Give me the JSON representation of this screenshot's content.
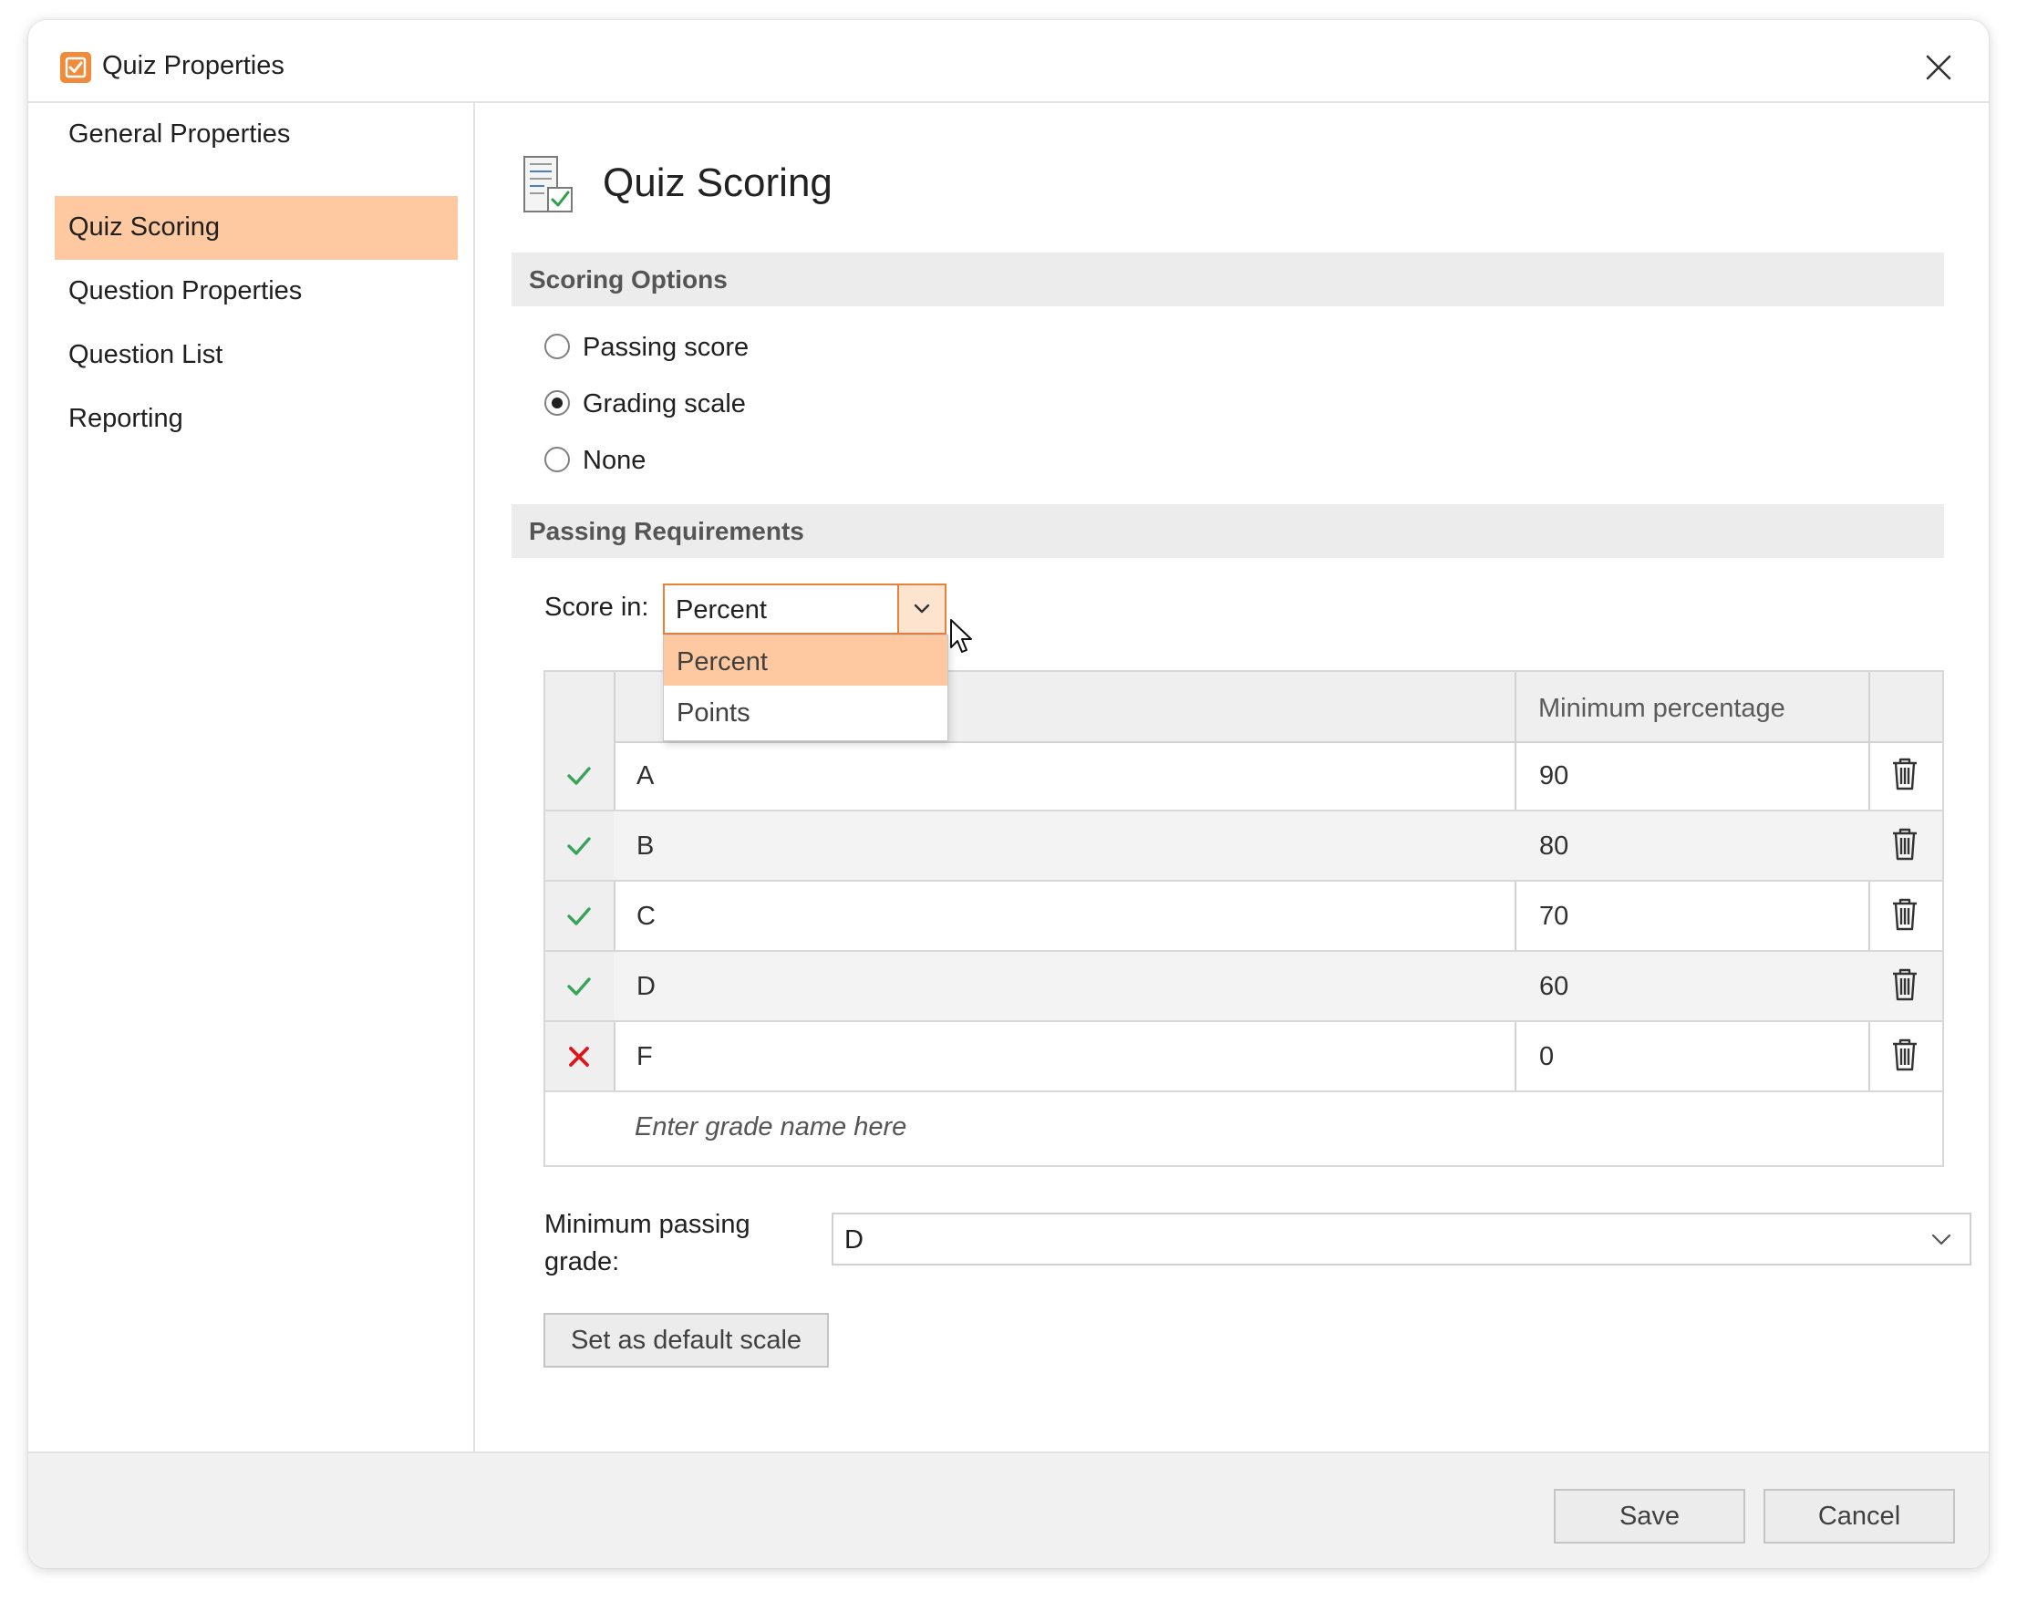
{
  "window": {
    "title": "Quiz Properties"
  },
  "sidebar": {
    "items": [
      {
        "label": "General Properties"
      },
      {
        "label": "Quiz Scoring",
        "active": true
      },
      {
        "label": "Question Properties"
      },
      {
        "label": "Question List"
      },
      {
        "label": "Reporting"
      }
    ]
  },
  "main": {
    "page_title": "Quiz Scoring",
    "scoring_options": {
      "header": "Scoring Options",
      "options": [
        {
          "label": "Passing score",
          "checked": false
        },
        {
          "label": "Grading scale",
          "checked": true
        },
        {
          "label": "None",
          "checked": false
        }
      ]
    },
    "passing_requirements": {
      "header": "Passing Requirements",
      "score_in_label": "Score in:",
      "score_in_value": "Percent",
      "score_in_options": [
        "Percent",
        "Points"
      ],
      "score_in_highlighted": "Percent"
    },
    "grade_table": {
      "columns": [
        "",
        "",
        "Minimum percentage",
        ""
      ],
      "rows": [
        {
          "status": "pass",
          "name": "A",
          "min": "90"
        },
        {
          "status": "pass",
          "name": "B",
          "min": "80"
        },
        {
          "status": "pass",
          "name": "C",
          "min": "70"
        },
        {
          "status": "pass",
          "name": "D",
          "min": "60"
        },
        {
          "status": "fail",
          "name": "F",
          "min": "0"
        }
      ],
      "new_row_placeholder": "Enter grade name here"
    },
    "minimum_passing_grade": {
      "label": "Minimum passing grade:",
      "value": "D"
    },
    "default_scale_button": "Set as default scale"
  },
  "footer": {
    "save_label": "Save",
    "cancel_label": "Cancel"
  },
  "colors": {
    "accent": "#ef8b3a",
    "selection": "#fec9a0",
    "pass": "#3aa35a",
    "fail": "#e0141c"
  },
  "icons": [
    "quiz-app-icon",
    "close-icon",
    "quiz-scoring-page-icon",
    "chevron-down-icon",
    "mouse-cursor-icon",
    "checkmark-icon",
    "x-mark-icon",
    "trash-icon"
  ]
}
